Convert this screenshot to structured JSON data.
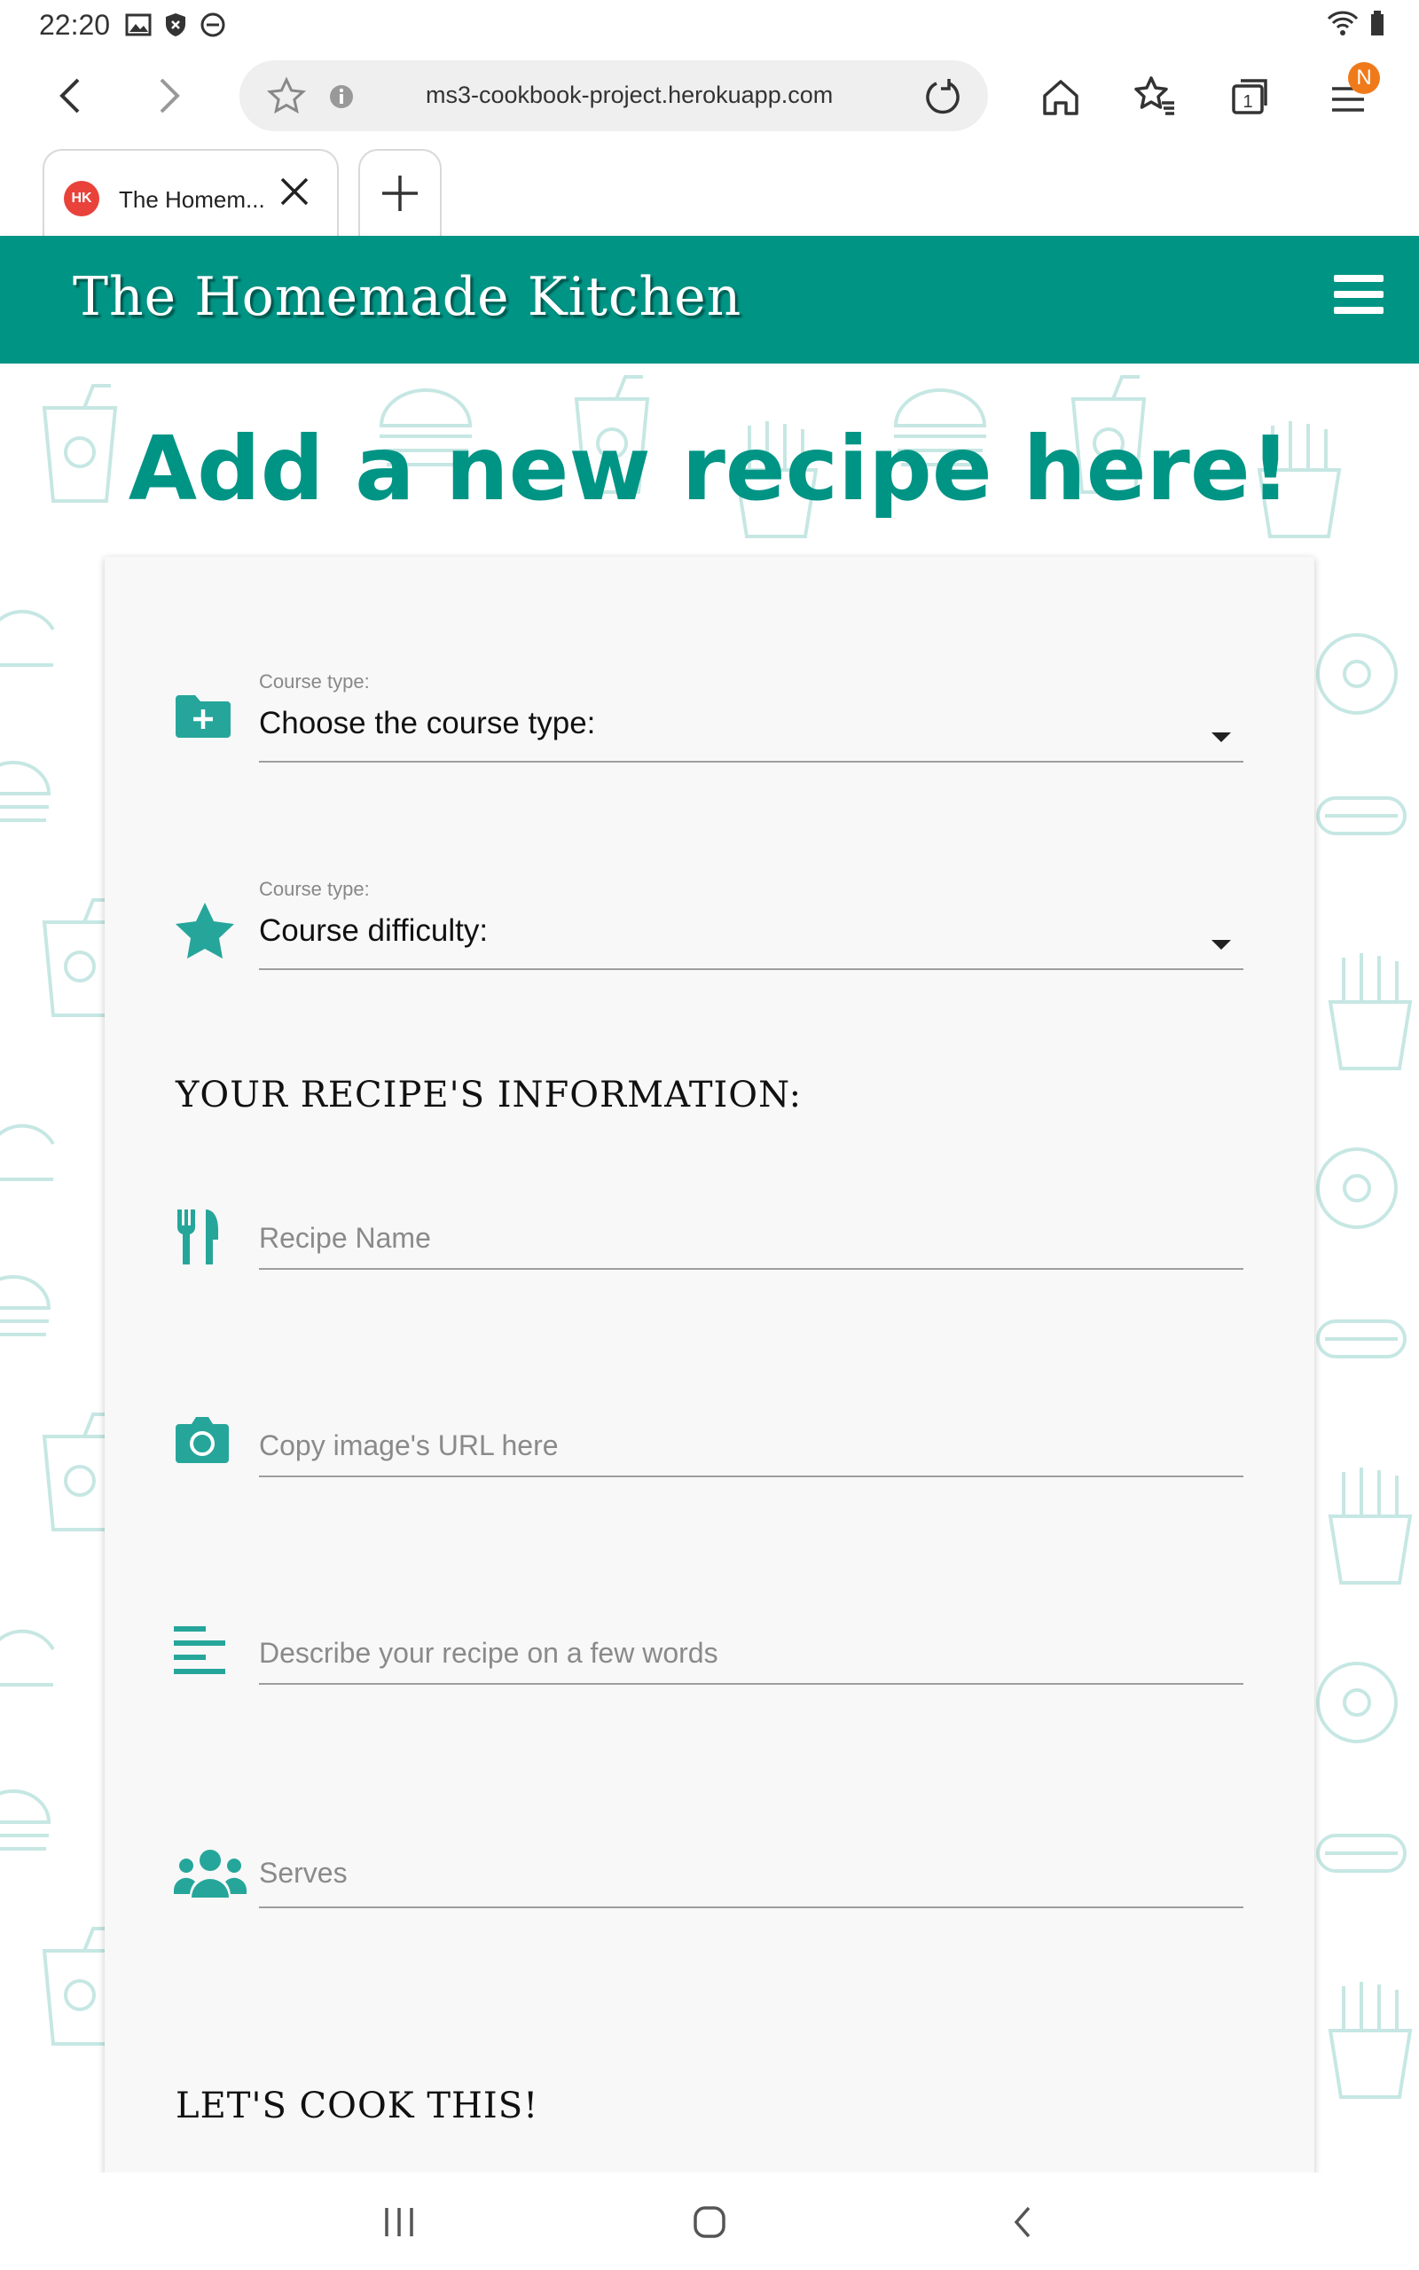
{
  "status_bar": {
    "time": "22:20"
  },
  "browser": {
    "url": "ms3-cookbook-project.herokuapp.com",
    "tab_count": "1",
    "menu_badge": "N",
    "tabs": [
      {
        "title": "The Homem...",
        "favicon_text": "HK"
      }
    ]
  },
  "site": {
    "brand": "The Homemade Kitchen",
    "page_title": "Add a new recipe here!"
  },
  "form": {
    "course_type": {
      "label": "Course type:",
      "value": "Choose the course type:"
    },
    "course_difficulty": {
      "label": "Course type:",
      "value": "Course difficulty:"
    },
    "section_info": "YOUR RECIPE'S INFORMATION:",
    "recipe_name": {
      "placeholder": "Recipe Name"
    },
    "image_url": {
      "placeholder": "Copy image's URL here"
    },
    "description": {
      "placeholder": "Describe your recipe on a few words"
    },
    "serves": {
      "placeholder": "Serves"
    },
    "section_cook": "LET'S COOK THIS!"
  },
  "colors": {
    "brand": "#009485",
    "icon": "#26a69a",
    "header_text": "#ffffff"
  },
  "icons": [
    "folder-plus-icon",
    "star-icon",
    "utensils-icon",
    "camera-icon",
    "align-left-icon",
    "users-icon"
  ]
}
